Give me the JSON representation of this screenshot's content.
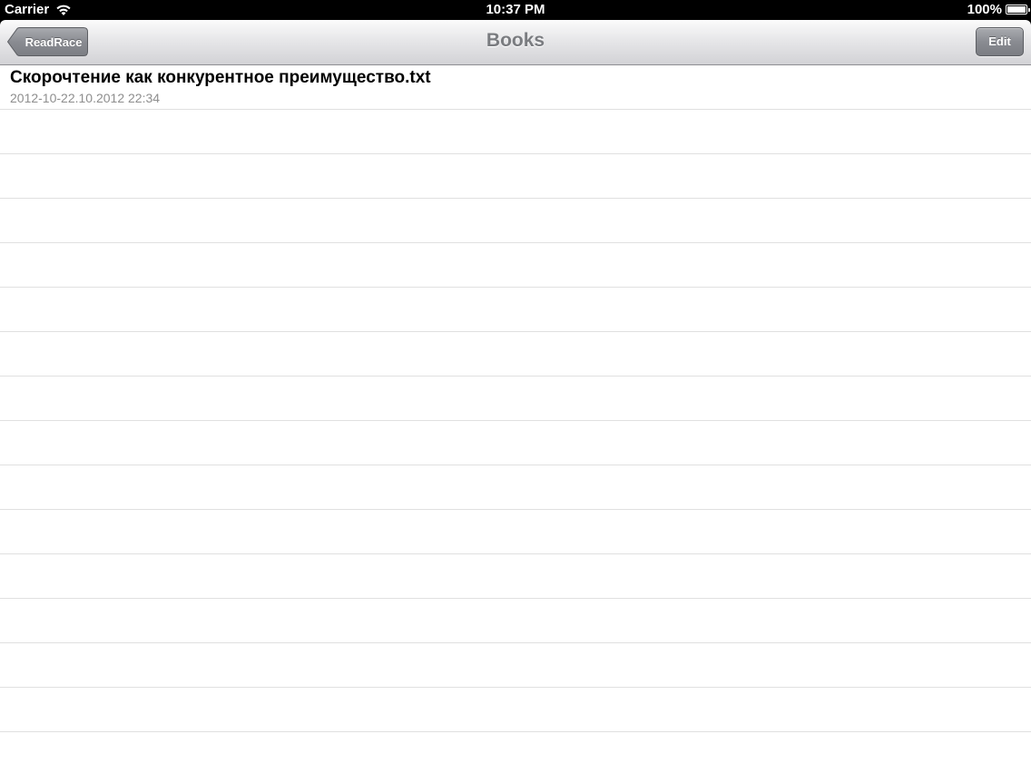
{
  "status_bar": {
    "carrier": "Carrier",
    "time": "10:37 PM",
    "battery": "100%"
  },
  "nav": {
    "title": "Books",
    "back_label": "ReadRace",
    "edit_label": "Edit"
  },
  "books": [
    {
      "title": "Скорочтение как конкурентное преимущество.txt",
      "subtitle": "2012-10-22.10.2012 22:34"
    }
  ],
  "empty_row_count": 15,
  "colors": {
    "nav_title": "#7a7c80",
    "button_gray": "#8a8c92",
    "separator": "#e0e0e0",
    "subtitle": "#8e8e8e"
  }
}
